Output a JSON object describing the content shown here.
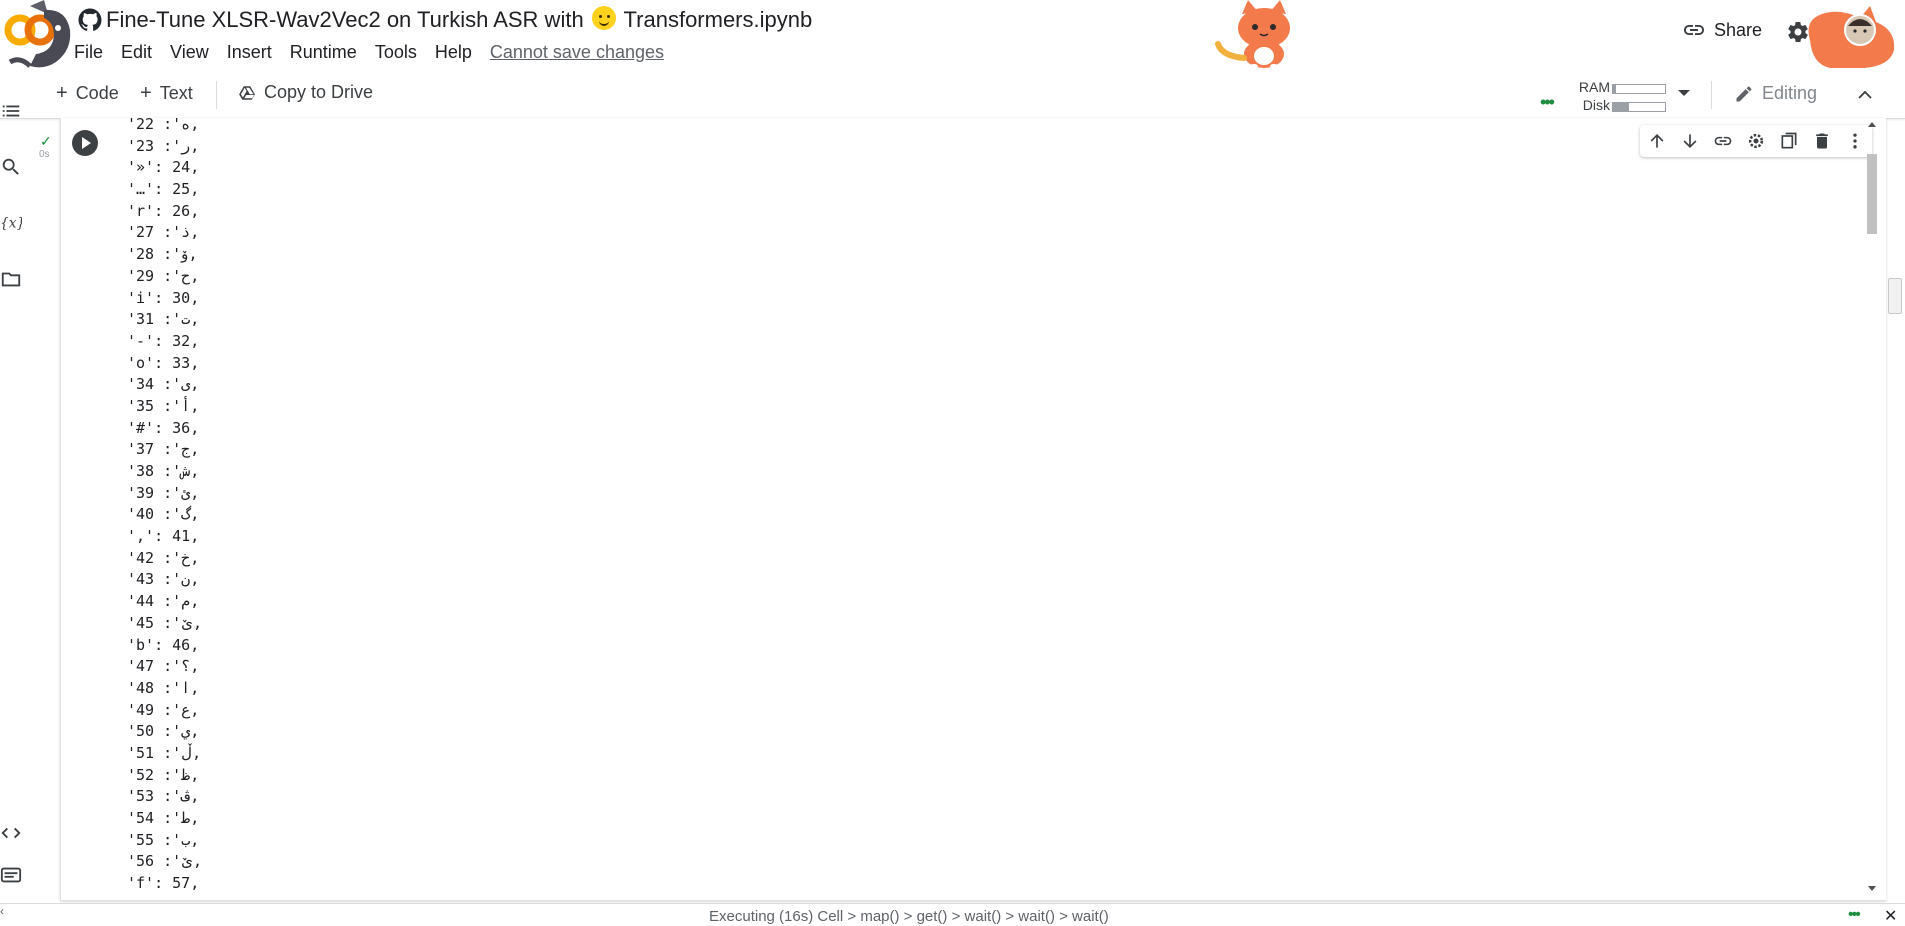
{
  "header": {
    "notebook_title": "Fine-Tune XLSR-Wav2Vec2 on Turkish ASR with",
    "notebook_title_suffix": "Transformers.ipynb",
    "share_label": "Share"
  },
  "menu": {
    "items": [
      "File",
      "Edit",
      "View",
      "Insert",
      "Runtime",
      "Tools",
      "Help"
    ],
    "cannot_save": "Cannot save changes"
  },
  "toolbar": {
    "code_label": "Code",
    "text_label": "Text",
    "copy_label": "Copy to Drive",
    "ram_label": "RAM",
    "disk_label": "Disk",
    "ram_usage": 0.05,
    "disk_usage": 0.3,
    "editing_label": "Editing"
  },
  "cell": {
    "exec_status": "✓",
    "exec_time": "0s",
    "output_lines": [
      "'ه': 22,",
      "'ر': 23,",
      "'»': 24,",
      "'…': 25,",
      "'r': 26,",
      "'ذ': 27,",
      "'ۆ': 28,",
      "'ح': 29,",
      "'i': 30,",
      "'ت': 31,",
      "'-': 32,",
      "'o': 33,",
      "'ی': 34,",
      "'أ': 35,",
      "'#': 36,",
      "'ج': 37,",
      "'ش': 38,",
      "'ئ': 39,",
      "'گ': 40,",
      "',': 41,",
      "'خ': 42,",
      "'ن': 43,",
      "'م': 44,",
      "'ێ': 45,",
      "'b': 46,",
      "'؟': 47,",
      "'ا': 48,",
      "'ع': 49,",
      "'ي': 50,",
      "'ڵ': 51,",
      "'ظ': 52,",
      "'ڤ': 53,",
      "'ط': 54,",
      "'ب': 55,",
      "'ێ': 56,",
      "'f': 57,"
    ]
  },
  "status": {
    "text": "Executing (16s)  Cell > map() > get() > wait() > wait() > wait()"
  },
  "colors": {
    "accent_green": "#1e8e3e",
    "colab_orange": "#F9AB00"
  }
}
